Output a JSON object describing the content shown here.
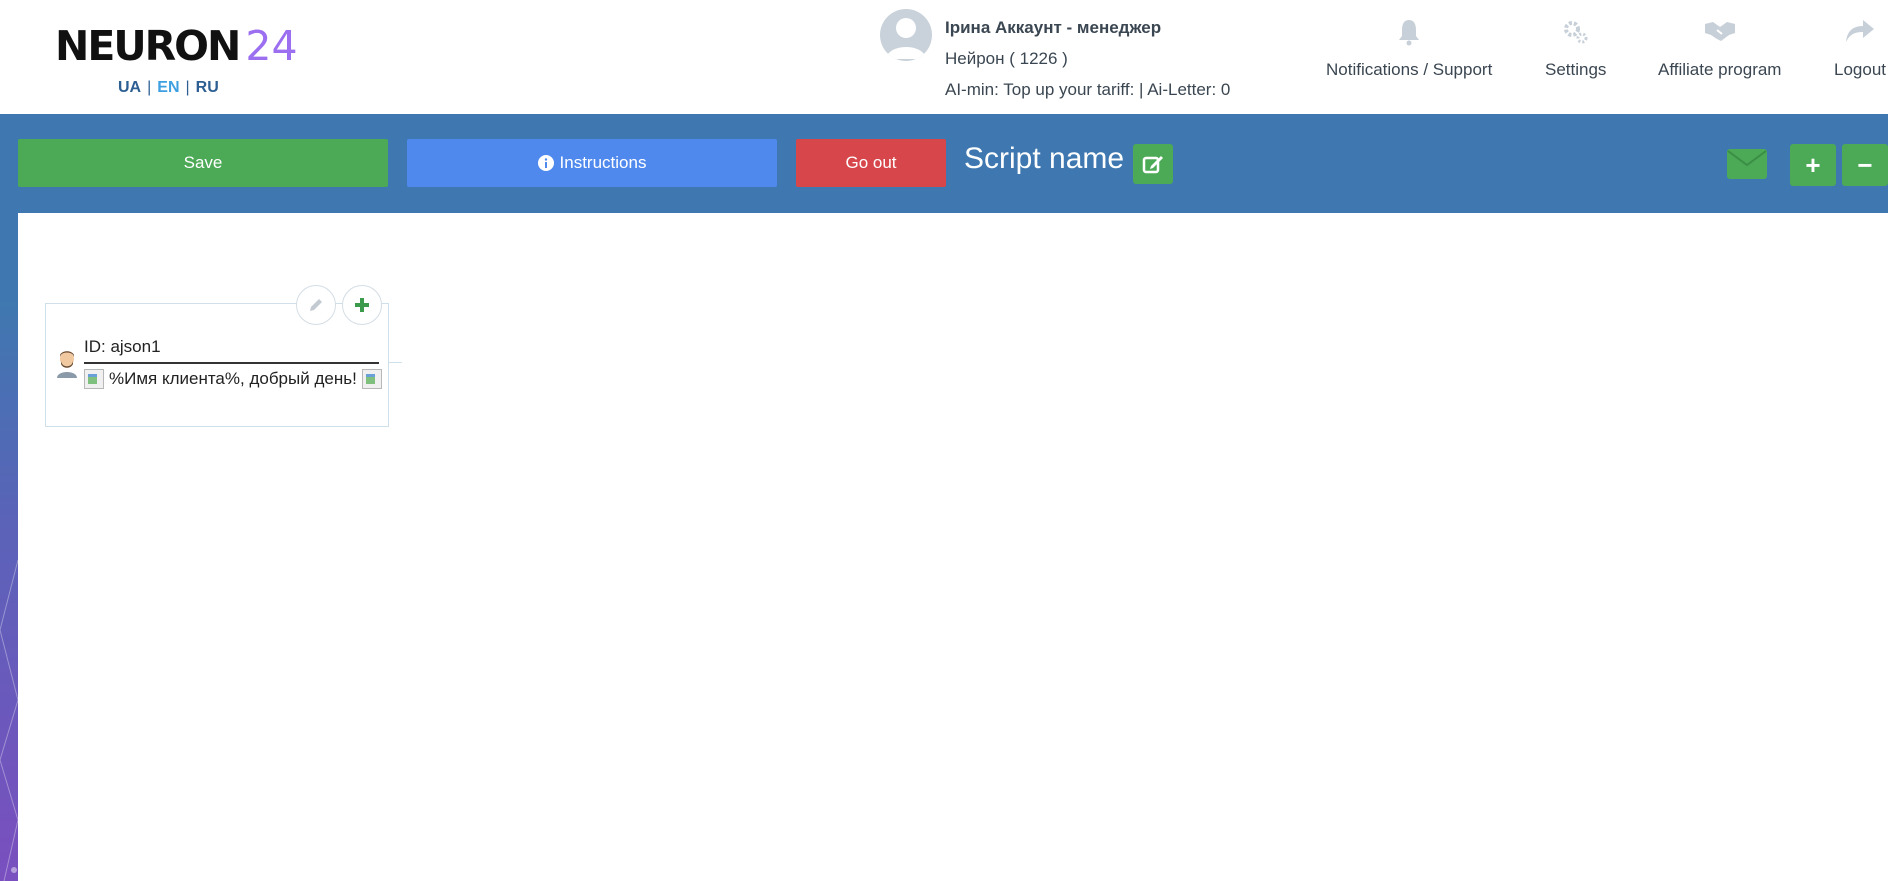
{
  "header": {
    "logo_text": "NEURON",
    "logo_number": "24",
    "languages": [
      "UA",
      "EN",
      "RU"
    ],
    "active_language": "EN",
    "user": {
      "name": "Ірина Аккаунт - менеджер",
      "balance": "Нейрон ( 1226 )",
      "ai_line": "AI-min: Top up your tariff: | Ai-Letter: 0"
    },
    "nav": [
      {
        "label": "Notifications / Support",
        "icon": "bell-icon"
      },
      {
        "label": "Settings",
        "icon": "gears-icon"
      },
      {
        "label": "Affiliate program",
        "icon": "handshake-icon"
      },
      {
        "label": "Logout",
        "icon": "share-arrow-icon"
      }
    ]
  },
  "toolbar": {
    "save_label": "Save",
    "instructions_label": "Instructions",
    "go_out_label": "Go out",
    "script_name": "Script name"
  },
  "node": {
    "id_label": "ID: ajson1",
    "message": "%Имя клиента%, добрый день!"
  },
  "colors": {
    "save": "#4caa57",
    "instructions": "#4f89ee",
    "go_out": "#d6464a",
    "toolbar_bg": "#3f78b0",
    "logo_accent": "#9b6ff0"
  }
}
